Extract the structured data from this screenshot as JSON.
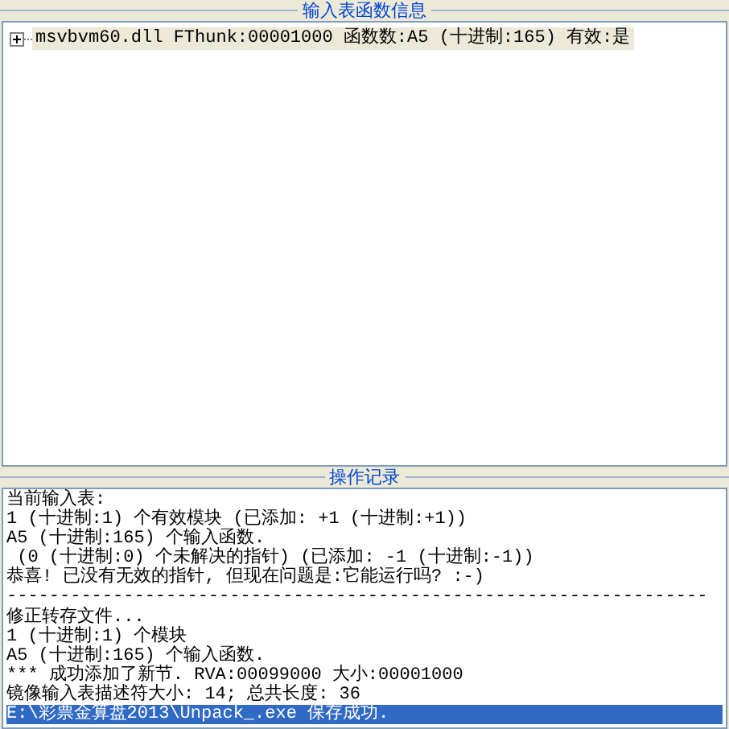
{
  "import_panel": {
    "title": "输入表函数信息",
    "tree": [
      {
        "text": "msvbvm60.dll FThunk:00001000 函数数:A5 (十进制:165) 有效:是",
        "expanded": false,
        "selected": true
      }
    ]
  },
  "log_panel": {
    "title": "操作记录",
    "lines": [
      {
        "text": "当前输入表:",
        "selected": false
      },
      {
        "text": "1 (十进制:1) 个有效模块 (已添加: +1 (十进制:+1))",
        "selected": false
      },
      {
        "text": "A5 (十进制:165) 个输入函数.",
        "selected": false
      },
      {
        "text": " (0 (十进制:0) 个未解决的指针) (已添加: -1 (十进制:-1))",
        "selected": false
      },
      {
        "text": "恭喜! 已没有无效的指针, 但现在问题是:它能运行吗? :-)",
        "selected": false
      },
      {
        "text": "------------------------------------------------------------------",
        "selected": false
      },
      {
        "text": "修正转存文件...",
        "selected": false
      },
      {
        "text": "1 (十进制:1) 个模块",
        "selected": false
      },
      {
        "text": "A5 (十进制:165) 个输入函数.",
        "selected": false
      },
      {
        "text": "*** 成功添加了新节. RVA:00099000 大小:00001000",
        "selected": false
      },
      {
        "text": "镜像输入表描述符大小: 14; 总共长度: 36",
        "selected": false
      },
      {
        "text": "E:\\彩票金算盘2013\\Unpack_.exe 保存成功.",
        "selected": true
      }
    ]
  }
}
